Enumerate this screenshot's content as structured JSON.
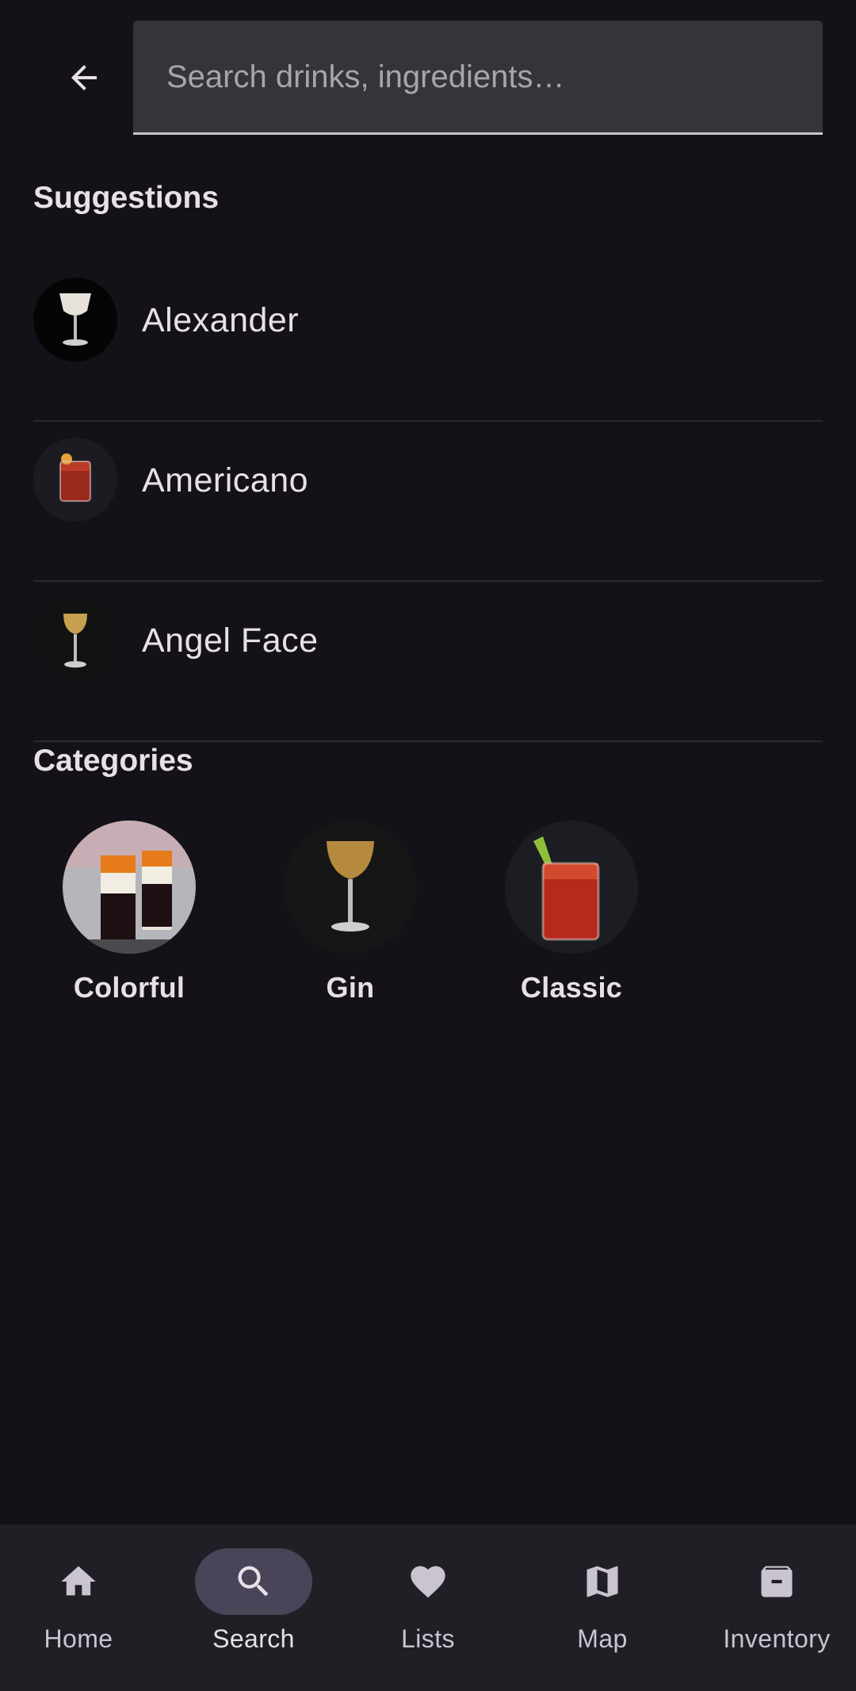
{
  "search": {
    "placeholder": "Search drinks, ingredients…",
    "value": ""
  },
  "suggestions": {
    "title": "Suggestions",
    "items": [
      {
        "name": "Alexander"
      },
      {
        "name": "Americano"
      },
      {
        "name": "Angel Face"
      }
    ]
  },
  "categories": {
    "title": "Categories",
    "items": [
      {
        "label": "Colorful"
      },
      {
        "label": "Gin"
      },
      {
        "label": "Classic"
      }
    ]
  },
  "nav": {
    "items": [
      {
        "label": "Home",
        "icon": "home-icon"
      },
      {
        "label": "Search",
        "icon": "search-icon",
        "active": true
      },
      {
        "label": "Lists",
        "icon": "heart-icon"
      },
      {
        "label": "Map",
        "icon": "map-icon"
      },
      {
        "label": "Inventory",
        "icon": "inventory-icon"
      }
    ]
  },
  "colors": {
    "background": "#141218",
    "surface": "#36343b",
    "nav_background": "#211f26",
    "active_indicator": "#4a4458",
    "text": "#e6e0e9"
  }
}
